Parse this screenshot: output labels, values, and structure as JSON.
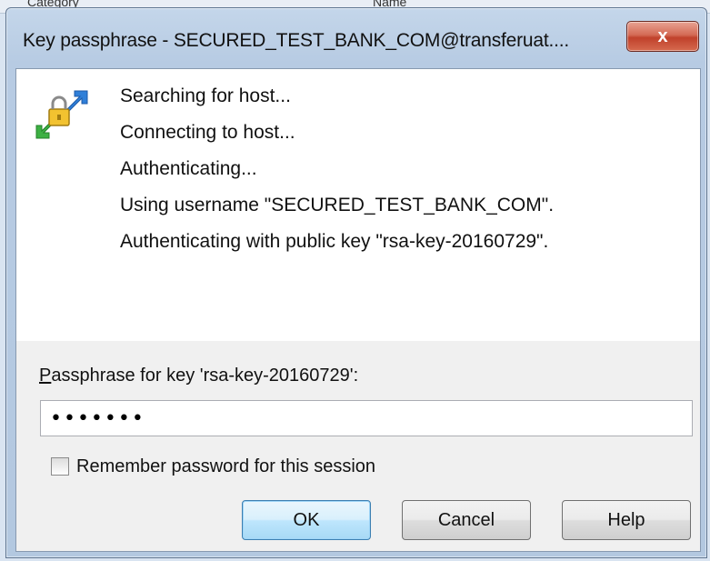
{
  "background": {
    "left_text": "Category",
    "right_text": "Name"
  },
  "window": {
    "title": "Key passphrase - SECURED_TEST_BANK_COM@transferuat....",
    "close_label": "x"
  },
  "log": {
    "lines": [
      "Searching for host...",
      "Connecting to host...",
      "Authenticating...",
      "Using username \"SECURED_TEST_BANK_COM\".",
      "Authenticating with public key \"rsa-key-20160729\"."
    ]
  },
  "form": {
    "passphrase_label_first": "P",
    "passphrase_label_rest": "assphrase for key 'rsa-key-20160729':",
    "passphrase_value": "•••••••",
    "remember_label": "Remember password for this session",
    "remember_checked": false
  },
  "buttons": {
    "ok": "OK",
    "cancel": "Cancel",
    "help": "Help"
  },
  "colors": {
    "title_bar": "#b7cbe3",
    "close_button": "#c0412b",
    "default_button": "#bee6fd"
  },
  "icons": {
    "app": "key-transfer-icon",
    "close": "close-icon"
  }
}
